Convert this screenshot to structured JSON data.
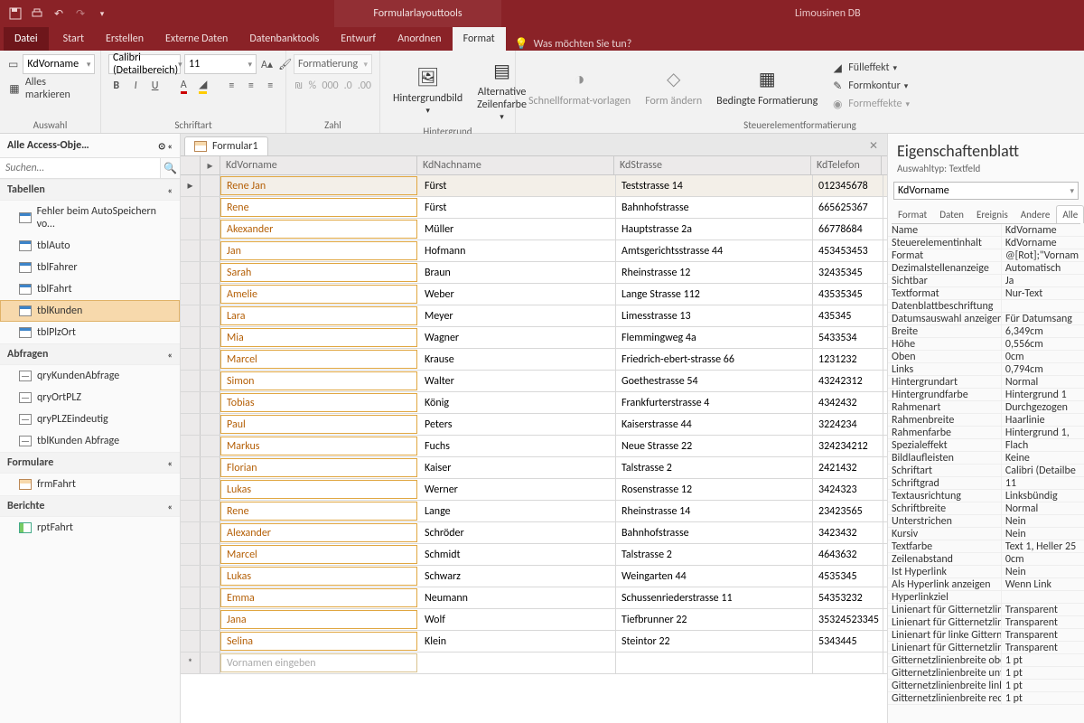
{
  "title": {
    "context": "Formularlayouttools",
    "dbname": "Limousinen DB"
  },
  "menu": {
    "file": "Datei",
    "items": [
      "Start",
      "Erstellen",
      "Externe Daten",
      "Datenbanktools",
      "Entwurf",
      "Anordnen",
      "Format"
    ],
    "active": "Format",
    "tellme": "Was möchten Sie tun?"
  },
  "ribbon": {
    "selection": {
      "combo": "KdVorname",
      "all": "Alles markieren",
      "label": "Auswahl"
    },
    "font": {
      "face": "Calibri (Detailbereich)",
      "size": "11",
      "label": "Schriftart"
    },
    "number": {
      "combo": "Formatierung",
      "label": "Zahl"
    },
    "bg": {
      "btn1": "Hintergrundbild",
      "btn2": "Alternative Zeilenfarbe",
      "label": "Hintergrund"
    },
    "styles": {
      "quick": "Schnellformat-vorlagen",
      "change": "Form ändern",
      "cond": "Bedingte Formatierung",
      "fill": "Fülleffekt",
      "outline": "Formkontur",
      "effects": "Formeffekte",
      "label": "Steuerelementformatierung"
    }
  },
  "nav": {
    "title": "Alle Access-Obje…",
    "searchPlaceholder": "Suchen…",
    "groups": [
      {
        "name": "Tabellen",
        "type": "tbl",
        "items": [
          "Fehler beim AutoSpeichern vo…",
          "tblAuto",
          "tblFahrer",
          "tblFahrt",
          "tblKunden",
          "tblPlzOrt"
        ],
        "selected": "tblKunden"
      },
      {
        "name": "Abfragen",
        "type": "qry",
        "items": [
          "qryKundenAbfrage",
          "qryOrtPLZ",
          "qryPLZEindeutig",
          "tblKunden Abfrage"
        ]
      },
      {
        "name": "Formulare",
        "type": "frm",
        "items": [
          "frmFahrt"
        ]
      },
      {
        "name": "Berichte",
        "type": "rpt",
        "items": [
          "rptFahrt"
        ]
      }
    ]
  },
  "form": {
    "tab": "Formular1",
    "columns": [
      "KdVorname",
      "KdNachname",
      "KdStrasse",
      "KdTelefon"
    ],
    "placeholder": "Vornamen eingeben",
    "rows": [
      [
        "Rene Jan",
        "Fürst",
        "Teststrasse 14",
        "012345678"
      ],
      [
        "Rene",
        "Fürst",
        "Bahnhofstrasse",
        "665625367"
      ],
      [
        "Akexander",
        "Müller",
        "Hauptstrasse 2a",
        "66778684"
      ],
      [
        "Jan",
        "Hofmann",
        "Amtsgerichtsstrasse 44",
        "453453453"
      ],
      [
        "Sarah",
        "Braun",
        "Rheinstrasse 12",
        "32435345"
      ],
      [
        "Amelie",
        "Weber",
        "Lange Strasse 112",
        "43535345"
      ],
      [
        "Lara",
        "Meyer",
        "Limesstrasse 13",
        "435345"
      ],
      [
        "Mia",
        "Wagner",
        "Flemmingweg 4a",
        "5433534"
      ],
      [
        "Marcel",
        "Krause",
        "Friedrich-ebert-strasse 66",
        "1231232"
      ],
      [
        "Simon",
        "Walter",
        "Goethestrasse 54",
        "43242312"
      ],
      [
        "Tobias",
        "König",
        "Frankfurterstrasse 4",
        "4342432"
      ],
      [
        "Paul",
        "Peters",
        "Kaiserstrasse 44",
        "3224234"
      ],
      [
        "Markus",
        "Fuchs",
        "Neue Strasse 22",
        "324234212"
      ],
      [
        "Florian",
        "Kaiser",
        "Talstrasse 2",
        "2421432"
      ],
      [
        "Lukas",
        "Werner",
        "Rosenstrasse 12",
        "3424323"
      ],
      [
        "Rene",
        "Lange",
        "Rheinstrasse 14",
        "23423565"
      ],
      [
        "Alexander",
        "Schröder",
        "Bahnhofstrasse",
        "3423432"
      ],
      [
        "Marcel",
        "Schmidt",
        "Talstrasse 2",
        "4643632"
      ],
      [
        "Lukas",
        "Schwarz",
        "Weingarten 44",
        "4535345"
      ],
      [
        "Emma",
        "Neumann",
        "Schussenriederstrasse 11",
        "54353232"
      ],
      [
        "Jana",
        "Wolf",
        "Tiefbrunner 22",
        "35324523345"
      ],
      [
        "Selina",
        "Klein",
        "Steintor 22",
        "5343445"
      ]
    ]
  },
  "prop": {
    "title": "Eigenschaftenblatt",
    "subtitle": "Auswahltyp: Textfeld",
    "combo": "KdVorname",
    "tabs": [
      "Format",
      "Daten",
      "Ereignis",
      "Andere",
      "Alle"
    ],
    "activeTab": "Alle",
    "rows": [
      [
        "Name",
        "KdVorname"
      ],
      [
        "Steuerelementinhalt",
        "KdVorname"
      ],
      [
        "Format",
        "@[Rot];\"Vornam"
      ],
      [
        "Dezimalstellenanzeige",
        "Automatisch"
      ],
      [
        "Sichtbar",
        "Ja"
      ],
      [
        "Textformat",
        "Nur-Text"
      ],
      [
        "Datenblattbeschriftung",
        ""
      ],
      [
        "Datumsauswahl anzeigen",
        "Für Datumsang"
      ],
      [
        "Breite",
        "6,349cm"
      ],
      [
        "Höhe",
        "0,556cm"
      ],
      [
        "Oben",
        "0cm"
      ],
      [
        "Links",
        "0,794cm"
      ],
      [
        "Hintergrundart",
        "Normal"
      ],
      [
        "Hintergrundfarbe",
        "Hintergrund 1"
      ],
      [
        "Rahmenart",
        "Durchgezogen"
      ],
      [
        "Rahmenbreite",
        "Haarlinie"
      ],
      [
        "Rahmenfarbe",
        "Hintergrund 1,"
      ],
      [
        "Spezialeffekt",
        "Flach"
      ],
      [
        "Bildlaufleisten",
        "Keine"
      ],
      [
        "Schriftart",
        "Calibri (Detailbe"
      ],
      [
        "Schriftgrad",
        "11"
      ],
      [
        "Textausrichtung",
        "Linksbündig"
      ],
      [
        "Schriftbreite",
        "Normal"
      ],
      [
        "Unterstrichen",
        "Nein"
      ],
      [
        "Kursiv",
        "Nein"
      ],
      [
        "Textfarbe",
        "Text 1, Heller 25"
      ],
      [
        "Zeilenabstand",
        "0cm"
      ],
      [
        "Ist Hyperlink",
        "Nein"
      ],
      [
        "Als Hyperlink anzeigen",
        "Wenn Link"
      ],
      [
        "Hyperlinkziel",
        ""
      ],
      [
        "Linienart für Gitternetzlinien o",
        "Transparent"
      ],
      [
        "Linienart für Gitternetzlinien u",
        "Transparent"
      ],
      [
        "Linienart für linke Gitternetzlin",
        "Transparent"
      ],
      [
        "Linienart für Gitternetzlinien re",
        "Transparent"
      ],
      [
        "Gitternetzlinienbreite oben",
        "1 pt"
      ],
      [
        "Gitternetzlinienbreite unten",
        "1 pt"
      ],
      [
        "Gitternetzlinienbreite links",
        "1 pt"
      ],
      [
        "Gitternetzlinienbreite rechts",
        "1 pt"
      ]
    ]
  }
}
